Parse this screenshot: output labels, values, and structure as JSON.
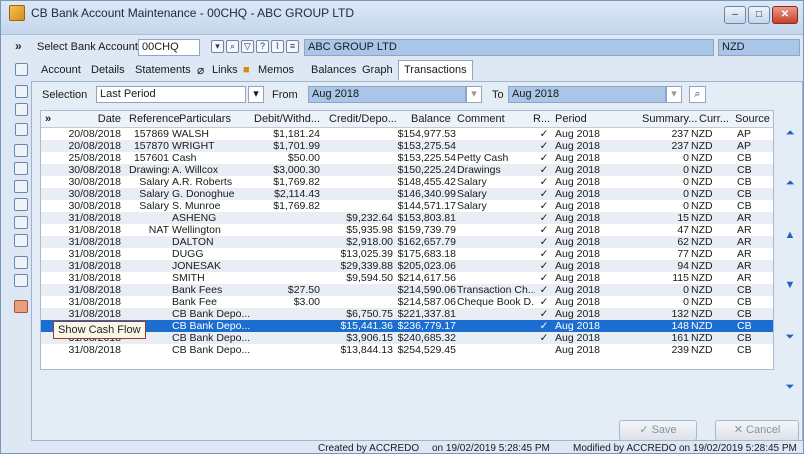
{
  "window": {
    "title": "CB Bank Account Maintenance - 00CHQ - ABC GROUP LTD",
    "buttons": {
      "min": "–",
      "max": "□",
      "close": "✕"
    }
  },
  "top": {
    "chevron": "»",
    "select_label": "Select Bank Account",
    "account_code": "00CHQ",
    "account_name": "ABC GROUP LTD",
    "currency": "NZD"
  },
  "tabs": [
    "Account",
    "Details",
    "Statements",
    "Links",
    "Memos",
    "Balances",
    "Graph",
    "Transactions"
  ],
  "selection": {
    "label": "Selection",
    "value": "Last Period",
    "from_label": "From",
    "from_value": "Aug 2018",
    "to_label": "To",
    "to_value": "Aug 2018"
  },
  "grid": {
    "chevron": "»",
    "headers": [
      "Date",
      "Reference",
      "Particulars",
      "Debit/Withd...",
      "Credit/Depo...",
      "Balance",
      "Comment",
      "R...",
      "Period",
      "Summary...",
      "Curr...",
      "Source"
    ],
    "rows": [
      [
        "20/08/2018",
        "157869",
        "WALSH",
        "$1,181.24",
        "",
        "$154,977.53",
        "",
        "✓",
        "Aug 2018",
        "237",
        "NZD",
        "AP"
      ],
      [
        "20/08/2018",
        "157870",
        "WRIGHT",
        "$1,701.99",
        "",
        "$153,275.54",
        "",
        "✓",
        "Aug 2018",
        "237",
        "NZD",
        "AP"
      ],
      [
        "25/08/2018",
        "157601",
        "Cash",
        "$50.00",
        "",
        "$153,225.54",
        "Petty Cash",
        "✓",
        "Aug 2018",
        "0",
        "NZD",
        "CB"
      ],
      [
        "30/08/2018",
        "Drawings",
        "A. Willcox",
        "$3,000.30",
        "",
        "$150,225.24",
        "Drawings",
        "✓",
        "Aug 2018",
        "0",
        "NZD",
        "CB"
      ],
      [
        "30/08/2018",
        "Salary",
        "A.R. Roberts",
        "$1,769.82",
        "",
        "$148,455.42",
        "Salary",
        "✓",
        "Aug 2018",
        "0",
        "NZD",
        "CB"
      ],
      [
        "30/08/2018",
        "Salary",
        "G. Donoghue",
        "$2,114.43",
        "",
        "$146,340.99",
        "Salary",
        "✓",
        "Aug 2018",
        "0",
        "NZD",
        "CB"
      ],
      [
        "30/08/2018",
        "Salary",
        "S. Munroe",
        "$1,769.82",
        "",
        "$144,571.17",
        "Salary",
        "✓",
        "Aug 2018",
        "0",
        "NZD",
        "CB"
      ],
      [
        "31/08/2018",
        "",
        "ASHENG",
        "",
        "$9,232.64",
        "$153,803.81",
        "",
        "✓",
        "Aug 2018",
        "15",
        "NZD",
        "AR"
      ],
      [
        "31/08/2018",
        "NAT",
        "Wellington",
        "",
        "$5,935.98",
        "$159,739.79",
        "",
        "✓",
        "Aug 2018",
        "47",
        "NZD",
        "AR"
      ],
      [
        "31/08/2018",
        "",
        "DALTON",
        "",
        "$2,918.00",
        "$162,657.79",
        "",
        "✓",
        "Aug 2018",
        "62",
        "NZD",
        "AR"
      ],
      [
        "31/08/2018",
        "",
        "DUGG",
        "",
        "$13,025.39",
        "$175,683.18",
        "",
        "✓",
        "Aug 2018",
        "77",
        "NZD",
        "AR"
      ],
      [
        "31/08/2018",
        "",
        "JONESAK",
        "",
        "$29,339.88",
        "$205,023.06",
        "",
        "✓",
        "Aug 2018",
        "94",
        "NZD",
        "AR"
      ],
      [
        "31/08/2018",
        "",
        "SMITH",
        "",
        "$9,594.50",
        "$214,617.56",
        "",
        "✓",
        "Aug 2018",
        "115",
        "NZD",
        "AR"
      ],
      [
        "31/08/2018",
        "",
        "Bank Fees",
        "$27.50",
        "",
        "$214,590.06",
        "Transaction Ch...",
        "✓",
        "Aug 2018",
        "0",
        "NZD",
        "CB"
      ],
      [
        "31/08/2018",
        "",
        "Bank Fee",
        "$3.00",
        "",
        "$214,587.06",
        "Cheque Book D...",
        "✓",
        "Aug 2018",
        "0",
        "NZD",
        "CB"
      ],
      [
        "31/08/2018",
        "",
        "CB Bank Depo...",
        "",
        "$6,750.75",
        "$221,337.81",
        "",
        "✓",
        "Aug 2018",
        "132",
        "NZD",
        "CB"
      ],
      [
        "31/08/2018",
        "",
        "CB Bank Depo...",
        "",
        "$15,441.36",
        "$236,779.17",
        "",
        "✓",
        "Aug 2018",
        "148",
        "NZD",
        "CB"
      ],
      [
        "31/08/2018",
        "",
        "CB Bank Depo...",
        "",
        "$3,906.15",
        "$240,685.32",
        "",
        "✓",
        "Aug 2018",
        "161",
        "NZD",
        "CB"
      ],
      [
        "31/08/2018",
        "",
        "CB Bank Depo...",
        "",
        "$13,844.13",
        "$254,529.45",
        "",
        "",
        "Aug 2018",
        "239",
        "NZD",
        "CB"
      ]
    ],
    "selected_row": 16
  },
  "tooltip": "Show Cash Flow",
  "buttons": {
    "save": "Save",
    "cancel": "Cancel"
  },
  "footer": {
    "created": "Created by ACCREDO",
    "created_on": "on 19/02/2019 5:28:45 PM",
    "modified": "Modified by ACCREDO",
    "modified_on": "on 19/02/2019 5:28:45 PM"
  }
}
